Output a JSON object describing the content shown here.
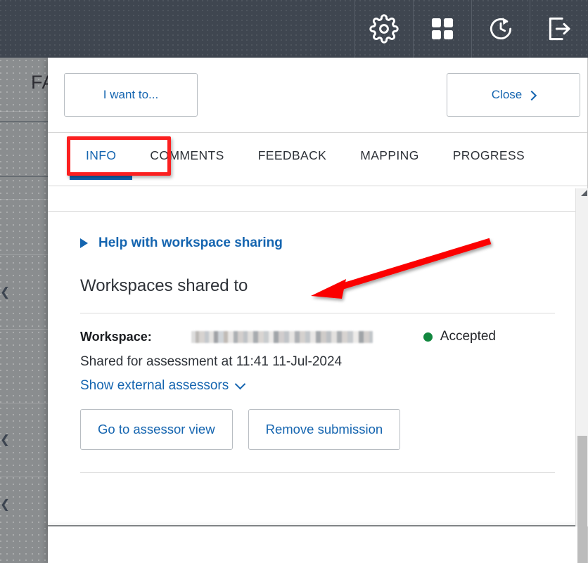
{
  "topbar": {
    "buttons": [
      {
        "name": "settings",
        "icon": "gear-icon",
        "label": "Settings"
      },
      {
        "name": "apps",
        "icon": "grid-apps-icon",
        "label": "Apps"
      },
      {
        "name": "history",
        "icon": "clock-refresh-icon",
        "label": "History"
      },
      {
        "name": "logout",
        "icon": "logout-icon",
        "label": "Log out"
      }
    ]
  },
  "background": {
    "partial_text": "FA",
    "chevron_icon": "chevron-left-icon"
  },
  "modal": {
    "header": {
      "i_want_to_label": "I want to...",
      "close_label": "Close",
      "close_icon": "chevron-right-icon"
    },
    "tabs": [
      {
        "label": "INFO",
        "active": true
      },
      {
        "label": "COMMENTS",
        "active": false
      },
      {
        "label": "FEEDBACK",
        "active": false
      },
      {
        "label": "MAPPING",
        "active": false
      },
      {
        "label": "PROGRESS",
        "active": false
      }
    ],
    "body": {
      "help_link": "Help with workspace sharing",
      "help_icon": "triangle-right-expand-icon",
      "section_title": "Workspaces shared to",
      "workspace": {
        "label": "Workspace:",
        "value": "",
        "value_redacted": true,
        "status_text": "Accepted",
        "status_color": "#12873f",
        "shared_text": "Shared for assessment at 11:41 11-Jul-2024",
        "show_assessors_label": "Show external assessors",
        "show_assessors_icon": "chevron-down-icon",
        "actions": [
          {
            "label": "Go to assessor view"
          },
          {
            "label": "Remove submission"
          }
        ]
      }
    }
  },
  "scrollbar": {
    "up_arrow_icon": "scroll-up-arrow-icon",
    "thumb_label": "scroll-thumb"
  },
  "annotations": {
    "highlight_color": "#fb2020",
    "arrow_color": "#fb0000",
    "highlight_target": "INFO",
    "arrow_target": "Workspaces shared to"
  }
}
